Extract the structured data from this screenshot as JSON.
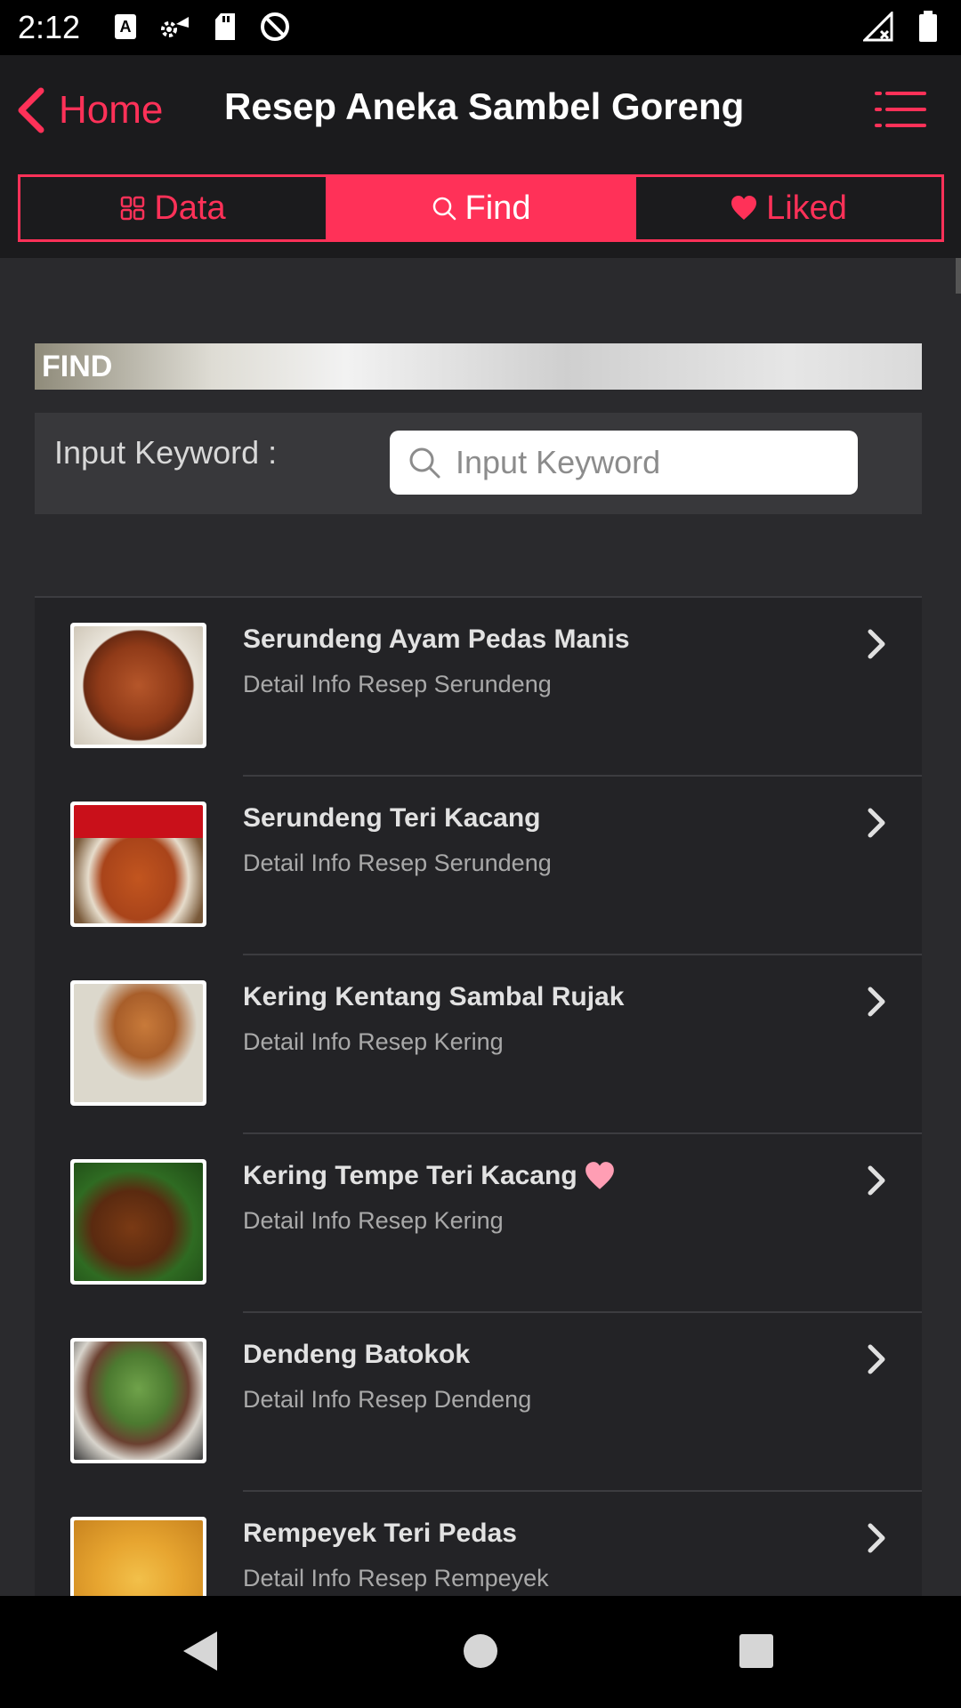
{
  "status_bar": {
    "time": "2:12"
  },
  "header": {
    "back_label": "Home",
    "title": "Resep Aneka Sambel Goreng",
    "accent_color": "#ff3158"
  },
  "tabs": [
    {
      "label": "Data",
      "icon": "grid-icon",
      "active": false
    },
    {
      "label": "Find",
      "icon": "search-icon",
      "active": true
    },
    {
      "label": "Liked",
      "icon": "heart-icon",
      "active": false
    }
  ],
  "find": {
    "banner": "FIND",
    "keyword_label": "Input Keyword :",
    "search_placeholder": "Input Keyword",
    "search_value": ""
  },
  "recipes": [
    {
      "title": "Serundeng Ayam Pedas Manis",
      "subtitle": "Detail Info Resep Serundeng",
      "liked": false
    },
    {
      "title": "Serundeng Teri Kacang",
      "subtitle": "Detail Info Resep Serundeng",
      "liked": false
    },
    {
      "title": "Kering Kentang Sambal Rujak",
      "subtitle": "Detail Info Resep Kering",
      "liked": false
    },
    {
      "title": "Kering Tempe Teri Kacang",
      "subtitle": "Detail Info Resep Kering",
      "liked": true
    },
    {
      "title": "Dendeng Batokok",
      "subtitle": "Detail Info Resep Dendeng",
      "liked": false
    },
    {
      "title": "Rempeyek Teri Pedas",
      "subtitle": "Detail Info Resep Rempeyek",
      "liked": false
    }
  ]
}
